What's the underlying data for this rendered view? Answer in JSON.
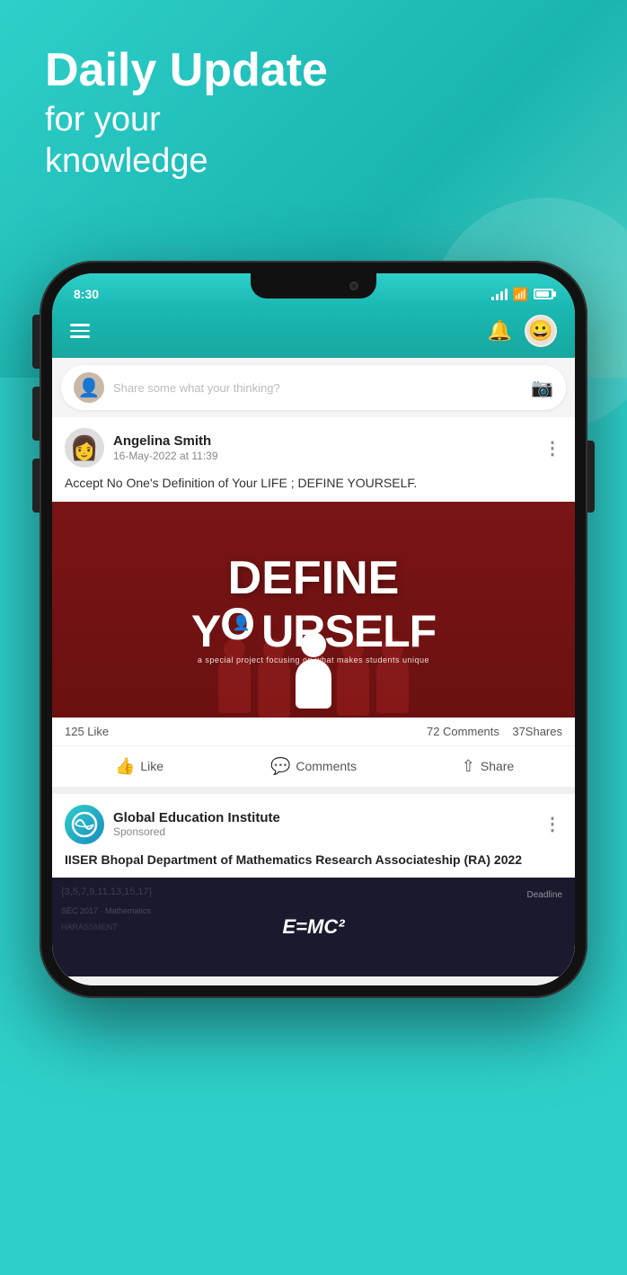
{
  "hero": {
    "title": "Daily Update",
    "subtitle_line1": "for your",
    "subtitle_line2": "knowledge",
    "bg_color": "#2ecfca"
  },
  "status_bar": {
    "time": "8:30"
  },
  "header": {
    "bell_label": "notifications",
    "avatar_label": "profile"
  },
  "post_input": {
    "placeholder": "Share some what your thinking?"
  },
  "posts": [
    {
      "author": "Angelina Smith",
      "date": "16-May-2022 at 11:39",
      "text": "Accept No One's Definition of Your LIFE ; DEFINE YOURSELF.",
      "image_title_line1": "DEFINE",
      "image_title_line2": "YOURSELF",
      "image_subtitle": "a special project focusing on what makes students unique",
      "likes": "125 Like",
      "comments": "72 Comments",
      "shares": "37Shares",
      "like_label": "Like",
      "comment_label": "Comments",
      "share_label": "Share"
    }
  ],
  "sponsored_post": {
    "org_name": "Global Education Institute",
    "sponsored_label": "Sponsored",
    "text": "IISER Bhopal Department of Mathematics Research Associateship (RA) 2022",
    "math_formula": "E=MC²",
    "math_sequence": "{3,5,7,9,11,13,15,17}",
    "deadline_label": "Deadline"
  }
}
